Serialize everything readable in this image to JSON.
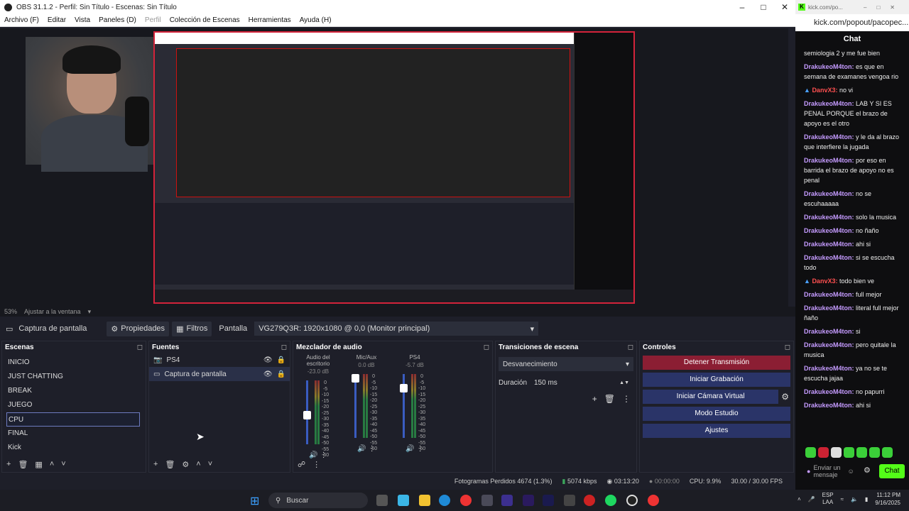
{
  "obs": {
    "title": "OBS 31.1.2 - Perfil: Sin Título - Escenas: Sin Título",
    "menu": [
      "Archivo (F)",
      "Editar",
      "Vista",
      "Paneles (D)",
      "Perfil",
      "Colección de Escenas",
      "Herramientas",
      "Ayuda (H)"
    ],
    "zoom": "53%",
    "fit": "Ajustar a la ventana",
    "source_bar": {
      "source": "Captura de pantalla",
      "props": "Propiedades",
      "filters": "Filtros",
      "display_label": "Pantalla",
      "display_value": "VG279Q3R: 1920x1080 @ 0,0 (Monitor principal)"
    },
    "scenes": {
      "title": "Escenas",
      "items": [
        "INICIO",
        "JUST CHATTING",
        "BREAK",
        "JUEGO",
        "CPU",
        "FINAL",
        "Kick"
      ],
      "selected": "CPU"
    },
    "sources": {
      "title": "Fuentes",
      "items": [
        "PS4",
        "Captura de pantalla"
      ]
    },
    "mixer": {
      "title": "Mezclador de audio",
      "channels": [
        {
          "name": "Audio del escritorio",
          "db": "-23.0 dB",
          "level": 0.45
        },
        {
          "name": "Mic/Aux",
          "db": "0.0 dB",
          "level": 1.0
        },
        {
          "name": "PS4",
          "db": "-5.7 dB",
          "level": 0.82
        }
      ],
      "scale": [
        "0",
        "-5",
        "-10",
        "-15",
        "-20",
        "-25",
        "-30",
        "-35",
        "-40",
        "-45",
        "-50",
        "-55",
        "-60"
      ]
    },
    "transitions": {
      "title": "Transiciones de escena",
      "type": "Desvanecimiento",
      "duration_label": "Duración",
      "duration_value": "150 ms"
    },
    "controls": {
      "title": "Controles",
      "buttons": [
        "Detener Transmisión",
        "Iniciar Grabación",
        "Iniciar Cámara Virtual",
        "Modo Estudio",
        "Ajustes"
      ]
    },
    "status": {
      "dropped": "Fotogramas Perdidos 4674 (1.3%)",
      "kbps": "5074 kbps",
      "stream_time": "03:13:20",
      "rec_time": "00:00:00",
      "cpu": "CPU: 9.9%",
      "fps": "30.00 / 30.00 FPS"
    }
  },
  "chat": {
    "tab": "kick.com/po...",
    "url": "kick.com/popout/pacopec...",
    "title": "Chat",
    "messages": [
      {
        "user": "",
        "text": "semiologia 2 y me fue bien",
        "red": false
      },
      {
        "user": "DrakukeoM4ton:",
        "text": "es que en semana de examanes vengoa rio",
        "red": false
      },
      {
        "user": "DanvX3:",
        "text": "no vi",
        "red": true
      },
      {
        "user": "DrakukeoM4ton:",
        "text": "LAB Y SI ES PENAL PORQUE el brazo de apoyo es el otro",
        "red": false
      },
      {
        "user": "DrakukeoM4ton:",
        "text": "y le da al brazo que interfiere la jugada",
        "red": false
      },
      {
        "user": "DrakukeoM4ton:",
        "text": "por eso en barrida el brazo de apoyo no es penal",
        "red": false
      },
      {
        "user": "DrakukeoM4ton:",
        "text": "no se escuhaaaaa",
        "red": false
      },
      {
        "user": "DrakukeoM4ton:",
        "text": "solo la musica",
        "red": false
      },
      {
        "user": "DrakukeoM4ton:",
        "text": "no ñaño",
        "red": false
      },
      {
        "user": "DrakukeoM4ton:",
        "text": "ahi si",
        "red": false
      },
      {
        "user": "DrakukeoM4ton:",
        "text": "si se escucha todo",
        "red": false
      },
      {
        "user": "DanvX3:",
        "text": "todo bien ve",
        "red": true
      },
      {
        "user": "DrakukeoM4ton:",
        "text": "full mejor",
        "red": false
      },
      {
        "user": "DrakukeoM4ton:",
        "text": "literal full mejor ñaño",
        "red": false
      },
      {
        "user": "DrakukeoM4ton:",
        "text": "si",
        "red": false
      },
      {
        "user": "DrakukeoM4ton:",
        "text": "pero quitale la musica",
        "red": false
      },
      {
        "user": "DrakukeoM4ton:",
        "text": "ya no se te escucha jajaa",
        "red": false
      },
      {
        "user": "DrakukeoM4ton:",
        "text": "no papurri",
        "red": false
      },
      {
        "user": "DrakukeoM4ton:",
        "text": "ahi si",
        "red": false
      }
    ],
    "input_placeholder": "Enviar un mensaje",
    "send": "Chat"
  },
  "taskbar": {
    "search": "Buscar",
    "lang1": "ESP",
    "lang2": "LAA",
    "time": "11:12 PM",
    "date": "9/16/2025"
  },
  "colors": {
    "accent": "#2a3468",
    "stop": "#8b1e33",
    "kick": "#53fc18"
  }
}
